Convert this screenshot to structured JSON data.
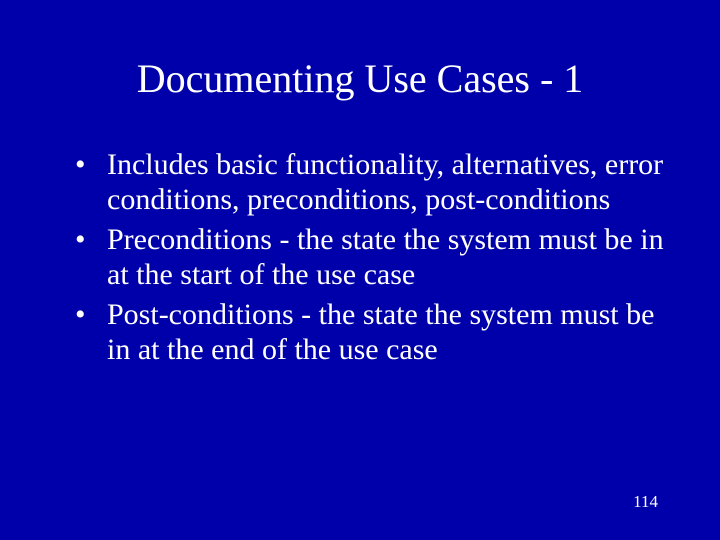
{
  "slide": {
    "title": "Documenting Use Cases - 1",
    "bullets": [
      "Includes basic functionality, alternatives, error conditions, preconditions, post-conditions",
      "Preconditions - the state the system must be in at the start of the use case",
      "Post-conditions - the state the system must be in at the end of the use case"
    ],
    "page_number": "114"
  }
}
